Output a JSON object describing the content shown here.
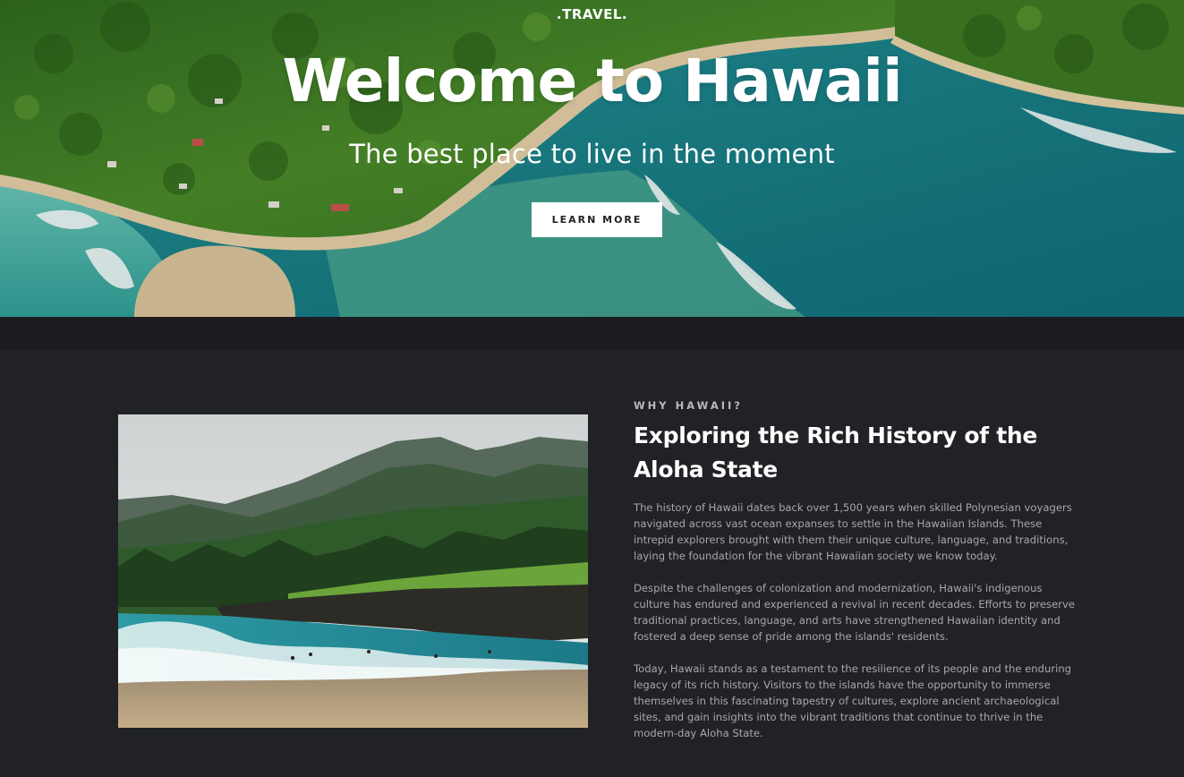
{
  "hero": {
    "logo": ".TRAVEL.",
    "title": "Welcome to Hawaii",
    "subtitle": "The best place to live in the moment",
    "cta_label": "LEARN MORE"
  },
  "about": {
    "eyebrow": "WHY HAWAII?",
    "title": "Exploring the Rich History of the Aloha State",
    "paragraphs": [
      "The history of Hawaii dates back over 1,500 years when skilled Polynesian voyagers navigated across vast ocean expanses to settle in the Hawaiian Islands. These intrepid explorers brought with them their unique culture, language, and traditions, laying the foundation for the vibrant Hawaiian society we know today.",
      "Despite the challenges of colonization and modernization, Hawaii's indigenous culture has endured and experienced a revival in recent decades. Efforts to preserve traditional practices, language, and arts have strengthened Hawaiian identity and fostered a deep sense of pride among the islands' residents.",
      "Today, Hawaii stands as a testament to the resilience of its people and the enduring legacy of its rich history. Visitors to the islands have the opportunity to immerse themselves in this fascinating tapestry of cultures, explore ancient archaeological sites, and gain insights into the vibrant traditions that continue to thrive in the modern-day Aloha State."
    ]
  },
  "colors": {
    "page_bg": "#202226",
    "band_bg": "#1b1b21",
    "ocean": "#1f7f86",
    "forest": "#3f7a25",
    "sand": "#d7c39a",
    "text_muted": "#a7a8ad"
  }
}
